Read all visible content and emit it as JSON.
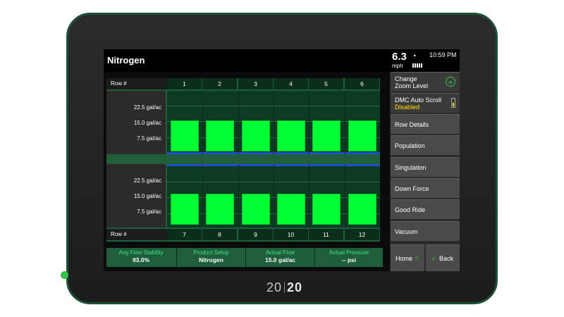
{
  "app": {
    "title": "Nitrogen"
  },
  "status": {
    "speed": "6.3",
    "speed_unit": "mph",
    "time": "10:59 PM"
  },
  "brand": {
    "left": "20",
    "right": "20"
  },
  "colors": {
    "accent": "#35c24a",
    "bar": "#00ff33",
    "panel": "#1e5e3a",
    "warning": "#ffe000"
  },
  "icons": {
    "gauge": "gauge-icon",
    "signal": "signal-icon",
    "zoom": "plus-icon",
    "home": "home-icon",
    "back": "chevron-left-icon"
  },
  "row_label": "Row #",
  "y_ticks": [
    "22.5 gal/ac",
    "15.0 gal/ac",
    "7.5 gal/ac"
  ],
  "y_max": 30,
  "top_rows": [
    {
      "row": "1",
      "rate": 15.0
    },
    {
      "row": "2",
      "rate": 15.0
    },
    {
      "row": "3",
      "rate": 15.0
    },
    {
      "row": "4",
      "rate": 15.0
    },
    {
      "row": "5",
      "rate": 15.0
    },
    {
      "row": "6",
      "rate": 15.0
    }
  ],
  "bottom_rows": [
    {
      "row": "7",
      "rate": 15.0
    },
    {
      "row": "8",
      "rate": 15.0
    },
    {
      "row": "9",
      "rate": 15.0
    },
    {
      "row": "10",
      "rate": 15.0
    },
    {
      "row": "11",
      "rate": 15.0
    },
    {
      "row": "12",
      "rate": 15.0
    }
  ],
  "stats": [
    {
      "label": "Avg Flow Stability",
      "value": "93.0%"
    },
    {
      "label": "Product Setup",
      "value": "Nitrogen"
    },
    {
      "label": "Actual Flow",
      "value": "15.0 gal/ac"
    },
    {
      "label": "Actual Pressure",
      "value": "-- psi"
    }
  ],
  "menu": {
    "zoom": {
      "line1": "Change",
      "line2": "Zoom Level"
    },
    "auto_scroll": {
      "label": "DMC Auto Scroll",
      "status": "Disabled"
    },
    "items": [
      "Row Details",
      "Population",
      "Singulation",
      "Down Force",
      "Good Ride",
      "Vacuum"
    ]
  },
  "nav": {
    "home": "Home",
    "back": "Back"
  }
}
